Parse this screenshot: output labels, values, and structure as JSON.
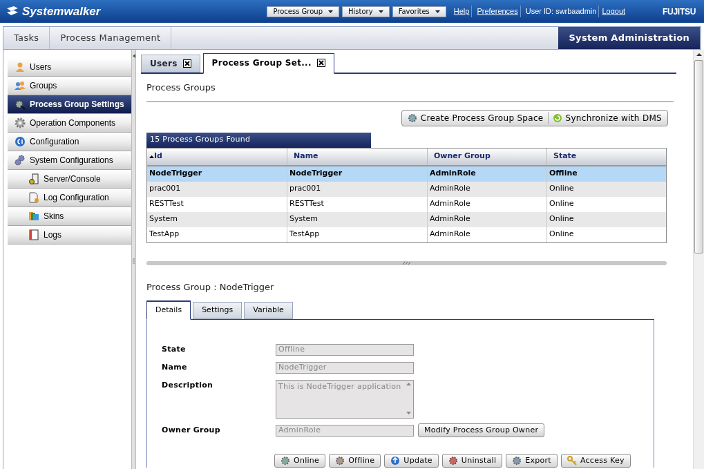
{
  "header": {
    "logo": "Systemwalker",
    "menus": [
      {
        "label": "Process Group"
      },
      {
        "label": "History"
      },
      {
        "label": "Favorites"
      }
    ],
    "links": [
      "Help",
      "Preferences"
    ],
    "user_id": "User ID: swrbaadmin",
    "logout": "Logout",
    "brand": "FUJITSU"
  },
  "nav": {
    "tabs": [
      {
        "label": "Tasks",
        "selected": false
      },
      {
        "label": "Process Management",
        "selected": false
      }
    ],
    "right_tab": {
      "label": "System Administration",
      "selected": true
    }
  },
  "sidebar": {
    "items": [
      {
        "label": "Users",
        "selected": false
      },
      {
        "label": "Groups",
        "selected": false
      },
      {
        "label": "Process Group Settings",
        "selected": true
      },
      {
        "label": "Operation Components",
        "selected": false
      },
      {
        "label": "Configuration",
        "selected": false
      },
      {
        "label": "System Configurations",
        "selected": false,
        "children": [
          {
            "label": "Server/Console",
            "selected": false
          },
          {
            "label": "Log Configuration",
            "selected": false
          },
          {
            "label": "Skins",
            "selected": false
          },
          {
            "label": "Logs",
            "selected": false
          }
        ]
      }
    ]
  },
  "tabs": [
    {
      "label": "Users",
      "selected": false
    },
    {
      "label": "Process Group Set...",
      "selected": true
    }
  ],
  "section_title": "Process Groups",
  "toolbar": [
    "Create Process Group Space",
    "Synchronize with DMS"
  ],
  "table": {
    "caption": "15 Process Groups Found",
    "columns": [
      {
        "label": "Id",
        "sorted": true
      },
      {
        "label": "Name",
        "sorted": false
      },
      {
        "label": "Owner Group",
        "sorted": false
      },
      {
        "label": "State",
        "sorted": false
      }
    ],
    "rows": [
      {
        "cells": [
          "NodeTrigger",
          "NodeTrigger",
          "AdminRole",
          "Offline"
        ],
        "selected": true
      },
      {
        "cells": [
          "prac001",
          "prac001",
          "AdminRole",
          "Online"
        ],
        "selected": false
      },
      {
        "cells": [
          "RESTTest",
          "RESTTest",
          "AdminRole",
          "Online"
        ],
        "selected": false
      },
      {
        "cells": [
          "System",
          "System",
          "AdminRole",
          "Online"
        ],
        "selected": false
      },
      {
        "cells": [
          "TestApp",
          "TestApp",
          "AdminRole",
          "Online"
        ],
        "selected": false
      }
    ]
  },
  "detail": {
    "title": "Process Group : NodeTrigger",
    "tabs": [
      {
        "label": "Details",
        "selected": true
      },
      {
        "label": "Settings",
        "selected": false
      },
      {
        "label": "Variable",
        "selected": false
      }
    ],
    "fields": [
      {
        "label": "State",
        "value": "Offline",
        "kind": "text",
        "disabled": true
      },
      {
        "label": "Name",
        "value": "NodeTrigger",
        "kind": "text",
        "disabled": true
      },
      {
        "label": "Description",
        "value": "This is NodeTrigger application",
        "kind": "textarea",
        "disabled": true
      },
      {
        "label": "Owner Group",
        "value": "AdminRole",
        "kind": "text",
        "disabled": true,
        "button": "Modify Process Group Owner"
      }
    ],
    "actions": [
      "Online",
      "Offline",
      "Update",
      "Uninstall",
      "Export",
      "Access Key"
    ]
  }
}
